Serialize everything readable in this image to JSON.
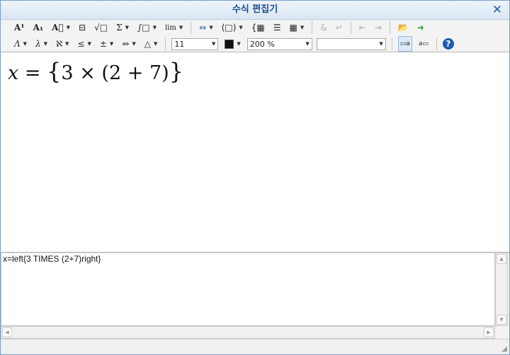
{
  "window": {
    "title": "수식 편집기",
    "close_glyph": "✕"
  },
  "toolbar1": [
    {
      "name": "superscript-button",
      "label": "A¹",
      "arrow": false
    },
    {
      "name": "subscript-button",
      "label": "A₁",
      "arrow": false
    },
    {
      "name": "decoration-button",
      "label": "A⃗",
      "arrow": true
    },
    {
      "name": "fraction-button",
      "label": "⊟",
      "arrow": false
    },
    {
      "name": "root-button",
      "label": "√□",
      "arrow": false
    },
    {
      "name": "sum-button",
      "label": "Σ",
      "arrow": true
    },
    {
      "name": "integral-button",
      "label": "∫□",
      "arrow": true
    },
    {
      "name": "limit-button",
      "label": "lim",
      "arrow": true
    }
  ],
  "toolbar1b": [
    {
      "name": "arrow-symbol-button",
      "label": "⇔",
      "arrow": true
    },
    {
      "name": "paren-button",
      "label": "(□)",
      "arrow": true
    },
    {
      "name": "matrix-case-button",
      "label": "{▦",
      "arrow": false
    },
    {
      "name": "align-button",
      "label": "☰",
      "arrow": false
    },
    {
      "name": "matrix-button",
      "label": "▦",
      "arrow": true
    }
  ],
  "toolbar1c": [
    {
      "name": "ampersand-button",
      "label": "&",
      "disabled": true
    },
    {
      "name": "newline-button",
      "label": "↵",
      "disabled": true
    }
  ],
  "toolbar1d": [
    {
      "name": "prev-button",
      "label": "⇤",
      "disabled": true
    },
    {
      "name": "next-button",
      "label": "⇥",
      "disabled": true
    }
  ],
  "toolbar1e": [
    {
      "name": "open-folder-button",
      "label": "📂"
    },
    {
      "name": "insert-button",
      "label": "➜"
    }
  ],
  "toolbar2": [
    {
      "name": "greek-upper-button",
      "label": "Λ"
    },
    {
      "name": "greek-lower-button",
      "label": "λ"
    },
    {
      "name": "special-symbol-button",
      "label": "ℵ"
    },
    {
      "name": "relation-button",
      "label": "≤"
    },
    {
      "name": "operator-button",
      "label": "±"
    },
    {
      "name": "arrow-button",
      "label": "⇔"
    },
    {
      "name": "misc-symbol-button",
      "label": "△"
    }
  ],
  "font_size": "11",
  "zoom": "200 %",
  "style_select": "",
  "text_color": "#000000",
  "formula": {
    "x": "x",
    "eq": "=",
    "lbrace": "{",
    "three": "3",
    "times": "×",
    "lparen": "(",
    "two": "2",
    "plus": "+",
    "seven": "7",
    "rparen": ")",
    "rbrace": "}"
  },
  "script": "x=left{3 TIMES (2+7)right}",
  "help_label": "?"
}
